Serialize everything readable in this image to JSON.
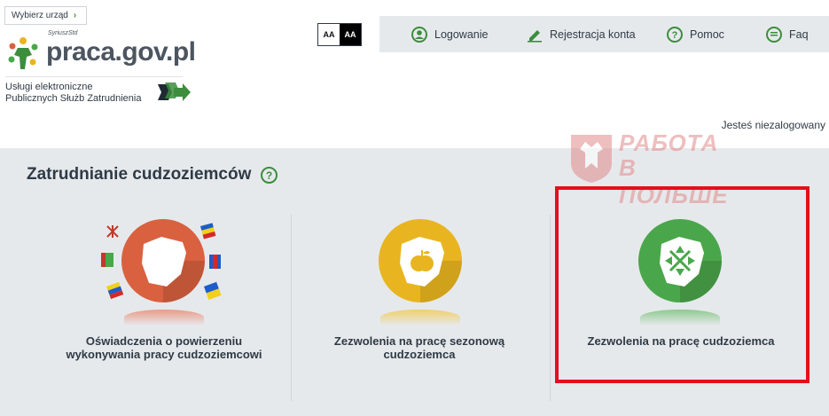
{
  "header": {
    "office_button_label": "Wybierz urząd",
    "logo_text": "praca.gov.pl",
    "logo_superscript": "SyriuszStd",
    "services_line1": "Usługi elektroniczne",
    "services_line2": "Publicznych Służb Zatrudnienia",
    "font_normal_label": "AA",
    "font_contrast_label": "AA",
    "login_status": "Jesteś niezalogowany"
  },
  "topnav": {
    "items": [
      {
        "label": "Logowanie",
        "icon": "user-icon"
      },
      {
        "label": "Rejestracja konta",
        "icon": "pencil-icon"
      },
      {
        "label": "Pomoc",
        "icon": "help-circle-icon"
      },
      {
        "label": "Faq",
        "icon": "chat-icon"
      }
    ]
  },
  "main": {
    "title": "Zatrudnianie cudzoziemców",
    "help_icon_label": "?",
    "watermark_line1": "РАБОТА",
    "watermark_line2": "В ПОЛЬШЕ",
    "cards": [
      {
        "label_line1": "Oświadczenia o powierzeniu",
        "label_line2": "wykonywania pracy cudzoziemcowi",
        "color": "#d9613f"
      },
      {
        "label_line1": "Zezwolenia na pracę sezonową",
        "label_line2": "cudzoziemca",
        "color": "#e8b520"
      },
      {
        "label_line1": "Zezwolenia na pracę cudzoziemca",
        "label_line2": "",
        "color": "#4aa64a"
      }
    ]
  },
  "colors": {
    "accent_green": "#3c8d3c",
    "nav_bg": "#e6e9ec",
    "highlight_red": "#e3101a"
  }
}
